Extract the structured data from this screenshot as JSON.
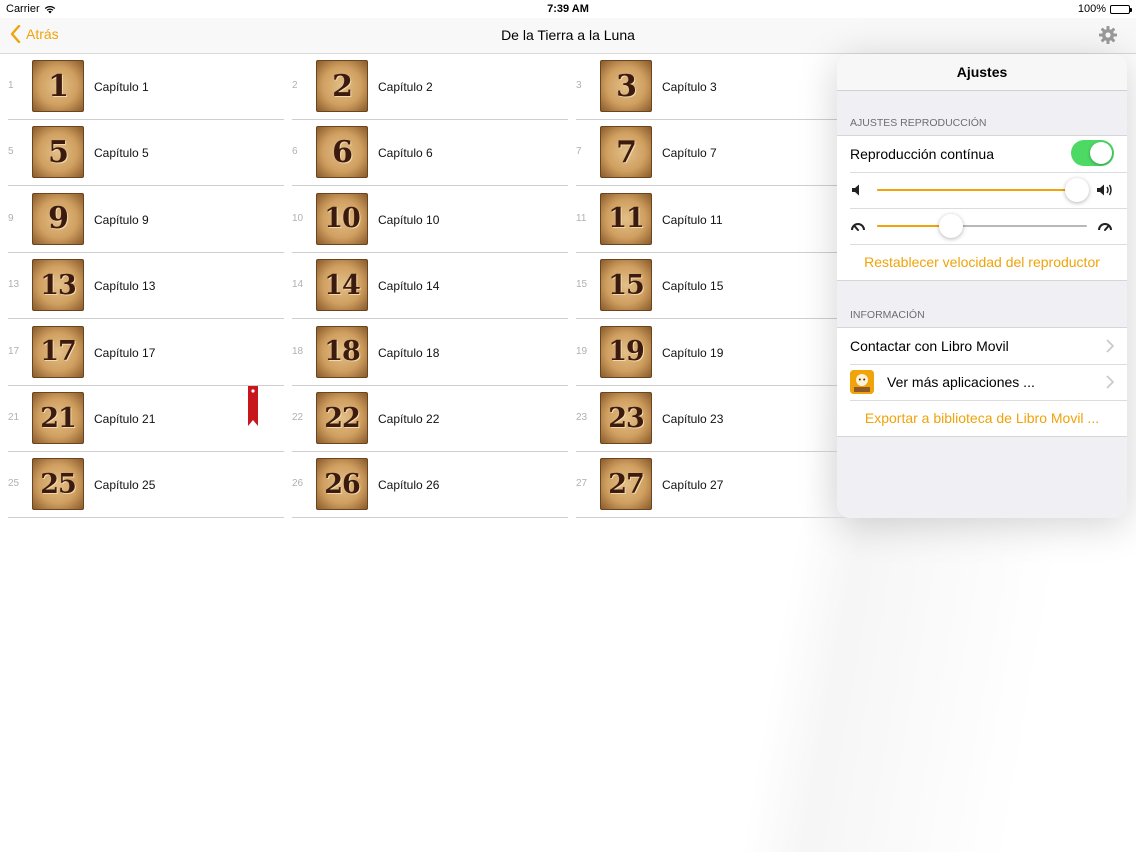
{
  "status_bar": {
    "carrier": "Carrier",
    "time": "7:39 AM",
    "battery": "100%"
  },
  "navbar": {
    "back_label": "Atrás",
    "title": "De la Tierra a la Luna"
  },
  "chapters": [
    {
      "num": "1",
      "thumb": "1",
      "label": "Capítulo 1"
    },
    {
      "num": "2",
      "thumb": "2",
      "label": "Capítulo 2"
    },
    {
      "num": "3",
      "thumb": "3",
      "label": "Capítulo 3"
    },
    {
      "num": "5",
      "thumb": "5",
      "label": "Capítulo 5"
    },
    {
      "num": "6",
      "thumb": "6",
      "label": "Capítulo 6"
    },
    {
      "num": "7",
      "thumb": "7",
      "label": "Capítulo 7"
    },
    {
      "num": "9",
      "thumb": "9",
      "label": "Capítulo 9"
    },
    {
      "num": "10",
      "thumb": "10",
      "label": "Capítulo 10"
    },
    {
      "num": "11",
      "thumb": "11",
      "label": "Capítulo 11"
    },
    {
      "num": "13",
      "thumb": "13",
      "label": "Capítulo 13"
    },
    {
      "num": "14",
      "thumb": "14",
      "label": "Capítulo 14"
    },
    {
      "num": "15",
      "thumb": "15",
      "label": "Capítulo 15"
    },
    {
      "num": "17",
      "thumb": "17",
      "label": "Capítulo 17"
    },
    {
      "num": "18",
      "thumb": "18",
      "label": "Capítulo 18"
    },
    {
      "num": "19",
      "thumb": "19",
      "label": "Capítulo 19"
    },
    {
      "num": "21",
      "thumb": "21",
      "label": "Capítulo 21"
    },
    {
      "num": "22",
      "thumb": "22",
      "label": "Capítulo 22"
    },
    {
      "num": "23",
      "thumb": "23",
      "label": "Capítulo 23"
    },
    {
      "num": "25",
      "thumb": "25",
      "label": "Capítulo 25"
    },
    {
      "num": "26",
      "thumb": "26",
      "label": "Capítulo 26"
    },
    {
      "num": "27",
      "thumb": "27",
      "label": "Capítulo 27"
    }
  ],
  "bookmarked_chapter": "21",
  "settings": {
    "title": "Ajustes",
    "playback_section": "AJUSTES REPRODUCCIÓN",
    "continuous_label": "Reproducción contínua",
    "continuous_on": true,
    "volume_level": 0.95,
    "speed_level": 0.35,
    "reset_speed_label": "Restablecer velocidad del reproductor",
    "info_section": "INFORMACIÓN",
    "contact_label": "Contactar con Libro Movil",
    "more_apps_label": "Ver más aplicaciones ...",
    "export_label": "Exportar a biblioteca de Libro Movil ..."
  },
  "colors": {
    "accent": "#f0a30a",
    "toggle_on": "#4cd964",
    "bookmark": "#c8161d"
  }
}
